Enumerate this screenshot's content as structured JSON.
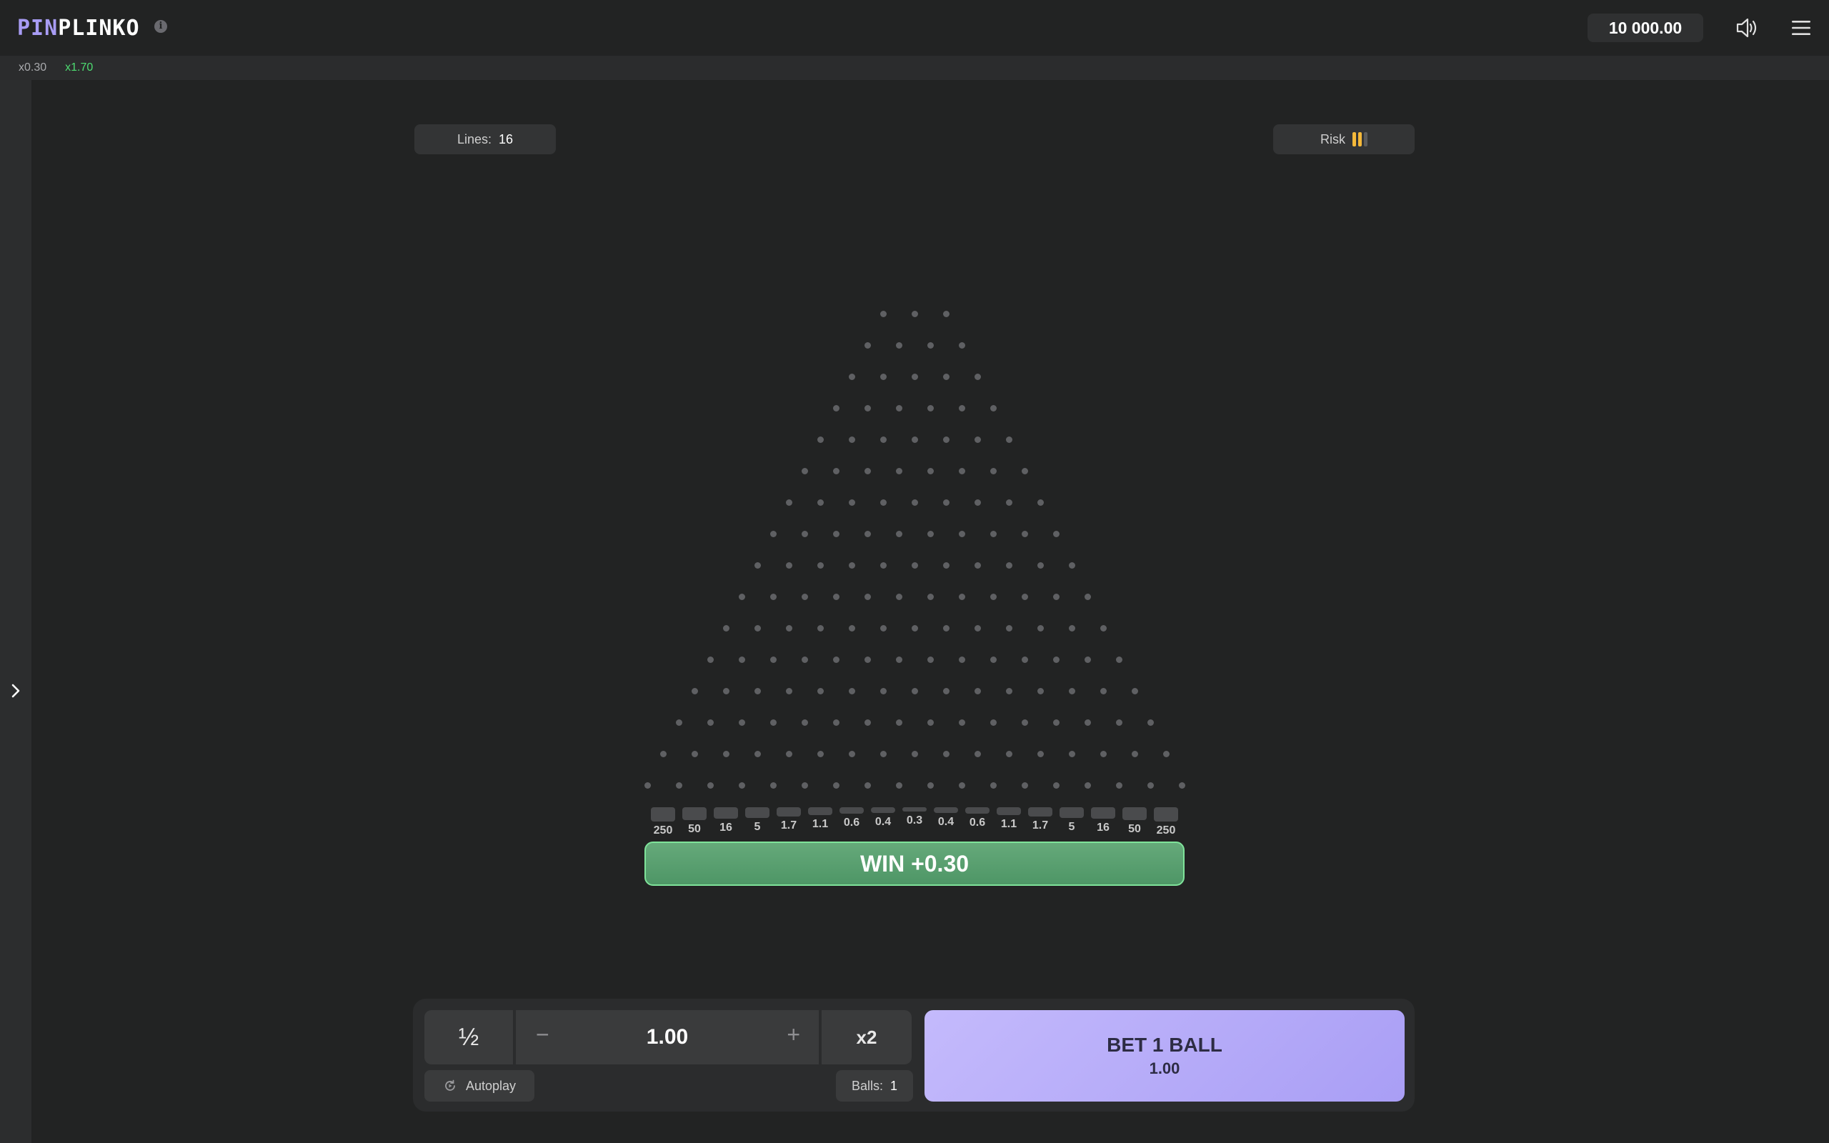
{
  "header": {
    "logo_part1": "PIN",
    "logo_part2": "PLINKO",
    "info_icon": "info-icon",
    "balance": "10 000.00",
    "sound_icon": "speaker-icon",
    "menu_icon": "hamburger-menu-icon"
  },
  "history": [
    "x0.30",
    "x1.70"
  ],
  "sidebar": {
    "toggle_icon": "chevron-right-icon"
  },
  "settings": {
    "lines_label": "Lines:",
    "lines_value": "16",
    "risk_label": "Risk",
    "risk_level": 2,
    "risk_levels_total": 3,
    "risk_color": "#f5b93a"
  },
  "board": {
    "rows": 16,
    "multipliers": [
      "250",
      "50",
      "16",
      "5",
      "1.7",
      "1.1",
      "0.6",
      "0.4",
      "0.3",
      "0.4",
      "0.6",
      "1.1",
      "1.7",
      "5",
      "16",
      "50",
      "250"
    ]
  },
  "result": {
    "win_text": "WIN +0.30"
  },
  "controls": {
    "half_label": "½",
    "minus_label": "−",
    "bet_amount": "1.00",
    "plus_label": "+",
    "double_label": "x2",
    "autoplay_label": "Autoplay",
    "balls_label": "Balls:",
    "balls_value": "1",
    "bet_button_label": "BET 1 BALL",
    "bet_button_amount": "1.00"
  },
  "colors": {
    "accent": "#a99ef5",
    "win_green": "#4ddc71",
    "background": "#222323"
  }
}
